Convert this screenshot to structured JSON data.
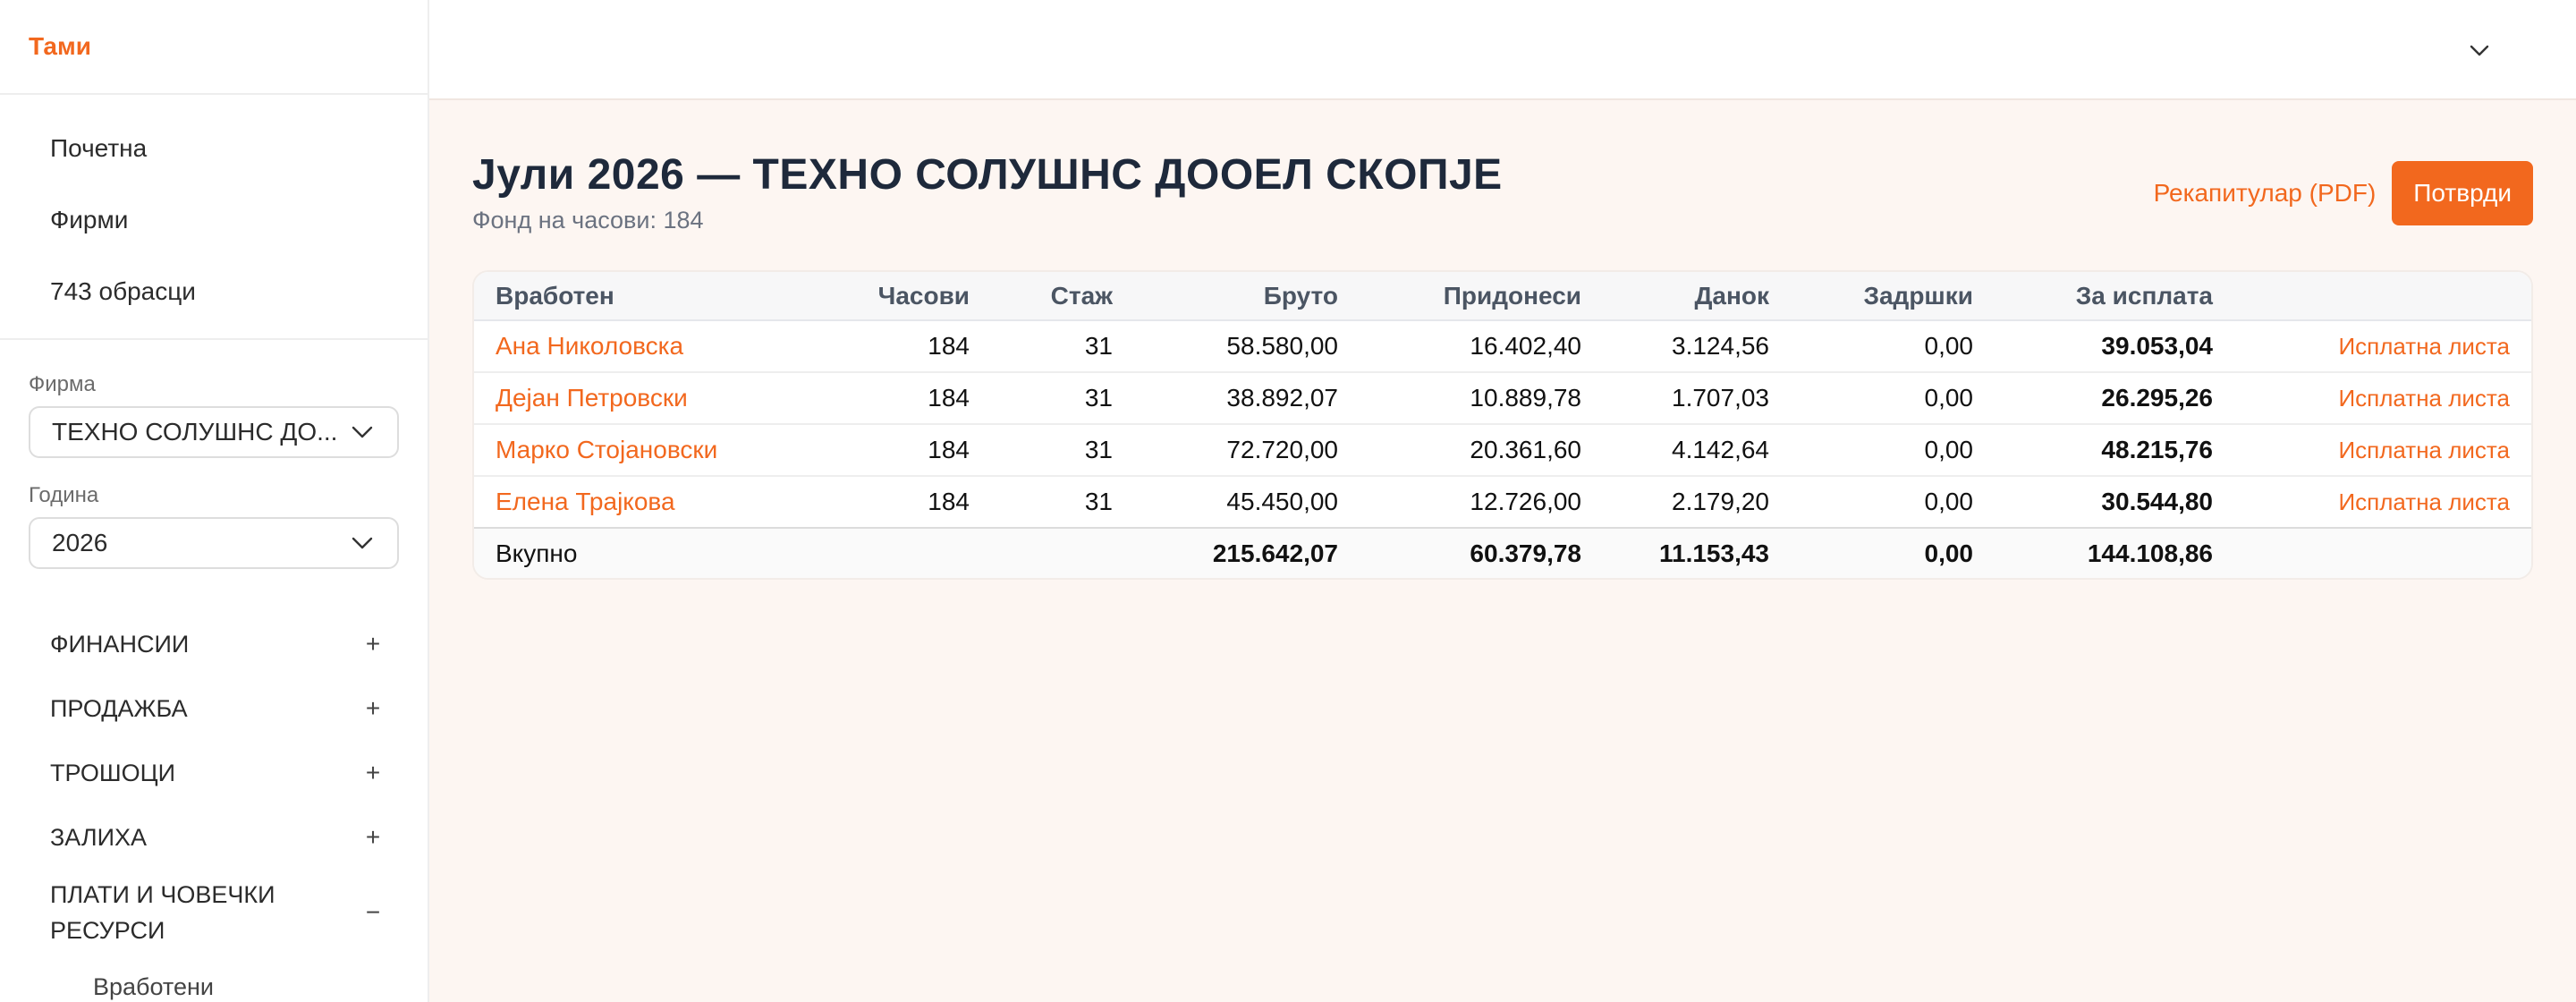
{
  "brand": "Тами",
  "nav": {
    "home": "Почетна",
    "firms": "Фирми",
    "forms743": "743 обрасци"
  },
  "filters": {
    "firm_label": "Фирма",
    "firm_value": "ТЕХНО СОЛУШНС ДО...",
    "year_label": "Година",
    "year_value": "2026"
  },
  "sections": [
    {
      "label": "ФИНАНСИИ",
      "toggle": "+"
    },
    {
      "label": "ПРОДАЖБА",
      "toggle": "+"
    },
    {
      "label": "ТРОШОЦИ",
      "toggle": "+"
    },
    {
      "label": "ЗАЛИХА",
      "toggle": "+"
    },
    {
      "label": "ПЛАТИ И ЧОВЕЧКИ РЕСУРСИ",
      "toggle": "−"
    }
  ],
  "subitems": {
    "employees": "Вработени"
  },
  "page": {
    "title": "Јули 2026 — ТЕХНО СОЛУШНС ДООЕЛ СКОПЈЕ",
    "subtitle": "Фонд на часови: 184",
    "recap_label": "Рекапитулар (PDF)",
    "confirm_label": "Потврди"
  },
  "table": {
    "headers": {
      "employee": "Вработен",
      "hours": "Часови",
      "tenure": "Стаж",
      "gross": "Бруто",
      "contributions": "Придонеси",
      "tax": "Данок",
      "deductions": "Задршки",
      "net": "За исплата"
    },
    "payslip_label": "Исплатна листа",
    "rows": [
      {
        "name": "Ана Николовска",
        "hours": "184",
        "tenure": "31",
        "gross": "58.580,00",
        "contributions": "16.402,40",
        "tax": "3.124,56",
        "deductions": "0,00",
        "net": "39.053,04"
      },
      {
        "name": "Дејан Петровски",
        "hours": "184",
        "tenure": "31",
        "gross": "38.892,07",
        "contributions": "10.889,78",
        "tax": "1.707,03",
        "deductions": "0,00",
        "net": "26.295,26"
      },
      {
        "name": "Марко Стојановски",
        "hours": "184",
        "tenure": "31",
        "gross": "72.720,00",
        "contributions": "20.361,60",
        "tax": "4.142,64",
        "deductions": "0,00",
        "net": "48.215,76"
      },
      {
        "name": "Елена Трајкова",
        "hours": "184",
        "tenure": "31",
        "gross": "45.450,00",
        "contributions": "12.726,00",
        "tax": "2.179,20",
        "deductions": "0,00",
        "net": "30.544,80"
      }
    ],
    "total": {
      "label": "Вкупно",
      "gross": "215.642,07",
      "contributions": "60.379,78",
      "tax": "11.153,43",
      "deductions": "0,00",
      "net": "144.108,86"
    }
  },
  "colors": {
    "accent": "#f2681e",
    "background": "#fdf6f2"
  },
  "icons": {
    "topbar": "chevron-down-icon",
    "select": "chevron-down-icon"
  }
}
